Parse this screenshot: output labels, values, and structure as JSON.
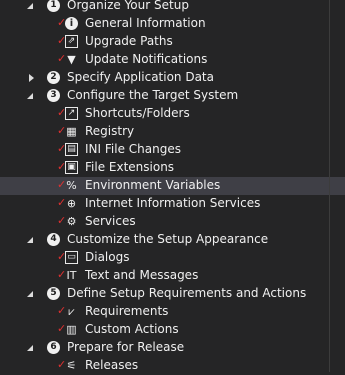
{
  "tree": [
    {
      "label": "Organize Your Setup",
      "number": "1",
      "expanded": true,
      "children": [
        {
          "label": "General Information",
          "icon": "info-icon"
        },
        {
          "label": "Upgrade Paths",
          "icon": "upgrade-icon"
        },
        {
          "label": "Update Notifications",
          "icon": "funnel-icon"
        }
      ]
    },
    {
      "label": "Specify Application Data",
      "number": "2",
      "expanded": false,
      "children": []
    },
    {
      "label": "Configure the Target System",
      "number": "3",
      "expanded": true,
      "children": [
        {
          "label": "Shortcuts/Folders",
          "icon": "shortcut-icon"
        },
        {
          "label": "Registry",
          "icon": "registry-icon"
        },
        {
          "label": "INI File Changes",
          "icon": "ini-file-icon"
        },
        {
          "label": "File Extensions",
          "icon": "file-extension-icon"
        },
        {
          "label": "Environment Variables",
          "icon": "percent-icon",
          "selected": true
        },
        {
          "label": "Internet Information Services",
          "icon": "globe-icon"
        },
        {
          "label": "Services",
          "icon": "gear-icon"
        }
      ]
    },
    {
      "label": "Customize the Setup Appearance",
      "number": "4",
      "expanded": true,
      "children": [
        {
          "label": "Dialogs",
          "icon": "dialog-icon"
        },
        {
          "label": "Text and Messages",
          "icon": "text-icon"
        }
      ]
    },
    {
      "label": "Define Setup Requirements and Actions",
      "number": "5",
      "expanded": true,
      "children": [
        {
          "label": "Requirements",
          "icon": "requirements-icon"
        },
        {
          "label": "Custom Actions",
          "icon": "custom-action-icon"
        }
      ]
    },
    {
      "label": "Prepare for Release",
      "number": "6",
      "expanded": true,
      "children": [
        {
          "label": "Releases",
          "icon": "releases-icon"
        }
      ]
    }
  ],
  "check_mark": "✓",
  "colors": {
    "background": "#252526",
    "selected": "#3f3f46",
    "check": "#e03030",
    "text": "#f0f0f0"
  }
}
